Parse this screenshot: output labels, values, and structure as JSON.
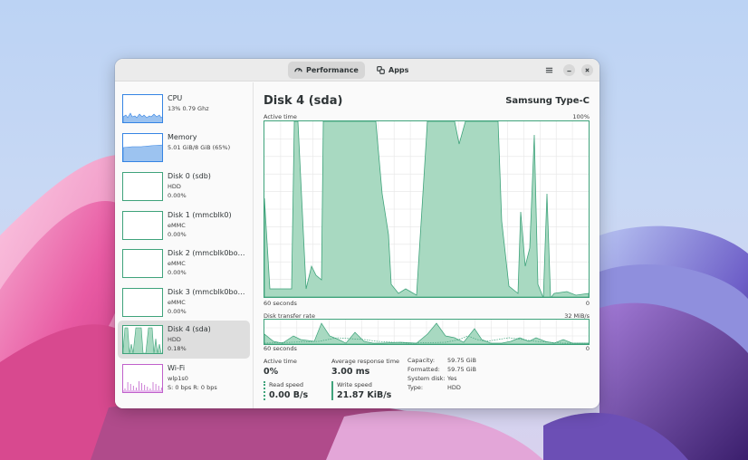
{
  "header": {
    "tabs": [
      {
        "label": "Performance",
        "icon": "gauge-icon",
        "active": true
      },
      {
        "label": "Apps",
        "icon": "apps-icon",
        "active": false
      }
    ],
    "menu_icon": "hamburger-menu-icon",
    "minimize_icon": "minimize-icon",
    "close_icon": "close-icon"
  },
  "sidebar": {
    "items": [
      {
        "name": "CPU",
        "line1": "13% 0.79 Ghz",
        "line2": ""
      },
      {
        "name": "Memory",
        "line1": "5.01 GiB/8 GiB (65%)",
        "line2": ""
      },
      {
        "name": "Disk 0 (sdb)",
        "line1": "HDD",
        "line2": "0.00%"
      },
      {
        "name": "Disk 1 (mmcblk0)",
        "line1": "eMMC",
        "line2": "0.00%"
      },
      {
        "name": "Disk 2 (mmcblk0bo…",
        "line1": "eMMC",
        "line2": "0.00%"
      },
      {
        "name": "Disk 3 (mmcblk0bo…",
        "line1": "eMMC",
        "line2": "0.00%"
      },
      {
        "name": "Disk 4 (sda)",
        "line1": "HDD",
        "line2": "0.18%",
        "selected": true
      },
      {
        "name": "Wi-Fi",
        "line1": "wlp1s0",
        "line2": "S: 0 bps R: 0 bps"
      }
    ]
  },
  "main": {
    "title": "Disk 4 (sda)",
    "model": "Samsung Type-C",
    "active_time_graph": {
      "label": "Active time",
      "max_label": "100%",
      "x_left": "60 seconds",
      "x_right": "0"
    },
    "transfer_graph": {
      "label": "Disk transfer rate",
      "max_label": "32 MiB/s",
      "x_left": "60 seconds",
      "x_right": "0"
    },
    "stats": {
      "active_time_label": "Active time",
      "active_time_value": "0%",
      "avg_response_label": "Average response time",
      "avg_response_value": "3.00 ms",
      "read_speed_label": "Read speed",
      "read_speed_value": "0.00 B/s",
      "write_speed_label": "Write speed",
      "write_speed_value": "21.87 KiB/s"
    },
    "details": [
      {
        "key": "Capacity:",
        "value": "59.75 GiB"
      },
      {
        "key": "Formatted:",
        "value": "59.75 GiB"
      },
      {
        "key": "System disk:",
        "value": "Yes"
      },
      {
        "key": "Type:",
        "value": "HDD"
      }
    ]
  },
  "colors": {
    "disk": "#3fa37b",
    "disk_fill": "#a8d9c1",
    "cpu": "#3584e4",
    "wifi": "#c061cb"
  }
}
